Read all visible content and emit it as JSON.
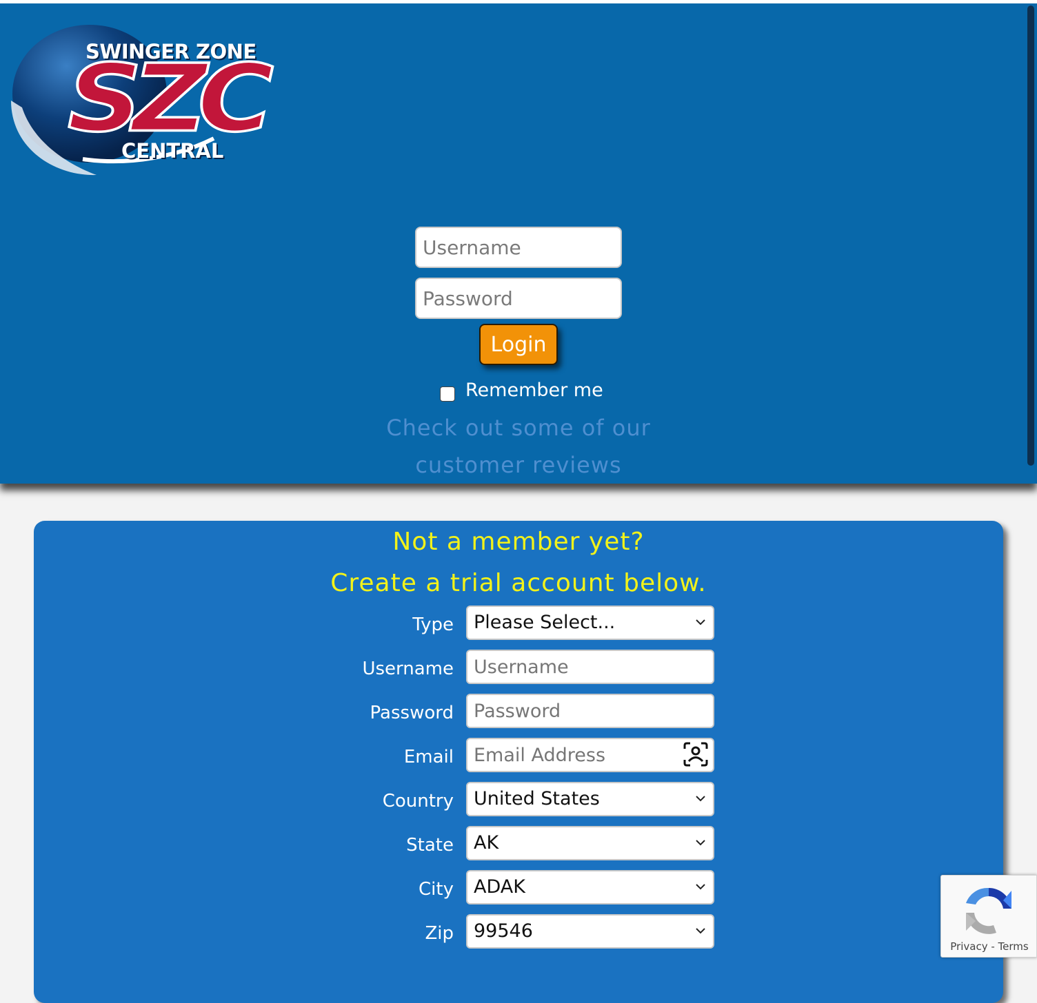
{
  "logo": {
    "line_top": "SWINGER ZONE",
    "line_big": "SZC",
    "line_bottom": "CENTRAL"
  },
  "login": {
    "username_placeholder": "Username",
    "password_placeholder": "Password",
    "button_label": "Login",
    "remember_label": "Remember me",
    "remember_checked": false,
    "reviews_line1": "Check out some of our",
    "reviews_line2": "customer reviews"
  },
  "signup": {
    "headline1": "Not a member yet?",
    "headline2": "Create a trial account below.",
    "type_label": "Type",
    "type_value": "Please Select...",
    "username_label": "Username",
    "username_placeholder": "Username",
    "password_label": "Password",
    "password_placeholder": "Password",
    "email_label": "Email",
    "email_placeholder": "Email Address",
    "country_label": "Country",
    "country_value": "United States",
    "state_label": "State",
    "state_value": "AK",
    "city_label": "City",
    "city_value": "ADAK",
    "zip_label": "Zip",
    "zip_value": "99546"
  },
  "recaptcha": {
    "privacy": "Privacy",
    "separator": " - ",
    "terms": "Terms"
  },
  "colors": {
    "header_bg": "#0868aa",
    "panel_bg": "#1a72c1",
    "accent_orange": "#f29208",
    "headline_yellow": "#f2f21a"
  }
}
